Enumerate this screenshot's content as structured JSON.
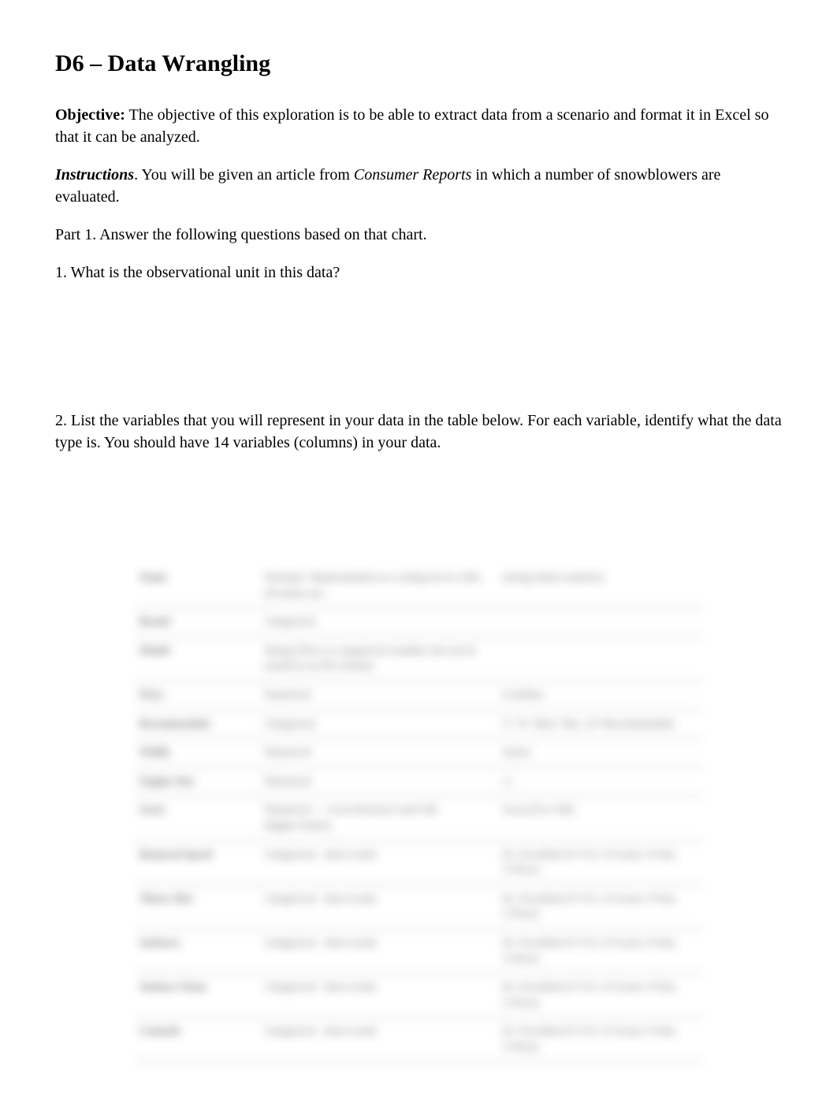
{
  "title": "D6 – Data Wrangling",
  "objective": {
    "label": "Objective:",
    "text": "  The objective of this exploration is to be able to extract data from a scenario and format it in Excel so that it can be analyzed."
  },
  "instructions": {
    "label": "Instructions",
    "text1": ".  You will be given an article from ",
    "italic": "Consumer Reports",
    "text2": " in which a number of snowblowers are evaluated."
  },
  "part1": "Part 1.  Answer the following questions based on that chart.",
  "q1": "1. What is the observational unit in this data?",
  "q2": "2.  List the variables that you will represent in your data in the table below.  For each variable, identify what the data type is.  You should have 14 variables (columns) in your data.",
  "table": {
    "rows": [
      {
        "c1": "Name",
        "c2": "Nominal / Representation as a string not in a file; all names are...",
        "c3": "(string unless numeric)"
      },
      {
        "c1": "Brand",
        "c2": "Categorical",
        "c3": ""
      },
      {
        "c1": "Model",
        "c2": "String (This is a categorical variable, but can be treated as an ID column)",
        "c3": ""
      },
      {
        "c1": "Price",
        "c2": "Numerical",
        "c3": "in dollars"
      },
      {
        "c1": "Recommended",
        "c2": "Categorical",
        "c3": "Y / N / Best / Rec. (Y=Recommended)"
      },
      {
        "c1": "Width",
        "c2": "Numerical",
        "c3": "inches"
      },
      {
        "c1": "Engine Size",
        "c2": "Numerical",
        "c3": "cc"
      },
      {
        "c1": "Score",
        "c2": "Numerical — score between 0 and 100 (higher=better)",
        "c3": "Score (0 to 100)"
      },
      {
        "c1": "Removal Speed",
        "c2": "Categorical - short words",
        "c3": "Ex. Excellent (5=V.G, 4=Good, 3=Fair, 2=Poor)"
      },
      {
        "c1": "Throw Dist",
        "c2": "Categorical - short words",
        "c3": "Ex. Excellent (5=V.G, 4=Good, 3=Fair, 2=Poor)"
      },
      {
        "c1": "Surfaces",
        "c2": "Categorical - short words",
        "c3": "Ex. Excellent (5=V.G, 4=Good, 3=Fair, 2=Poor)"
      },
      {
        "c1": "Surface Clean",
        "c2": "Categorical - short words",
        "c3": "Ex. Excellent (5=V.G, 4=Good, 3=Fair, 2=Poor)"
      },
      {
        "c1": "Controls",
        "c2": "Categorical - short words",
        "c3": "Ex. Excellent (5=V.G, 4=Good, 3=Fair, 2=Poor)"
      }
    ]
  }
}
